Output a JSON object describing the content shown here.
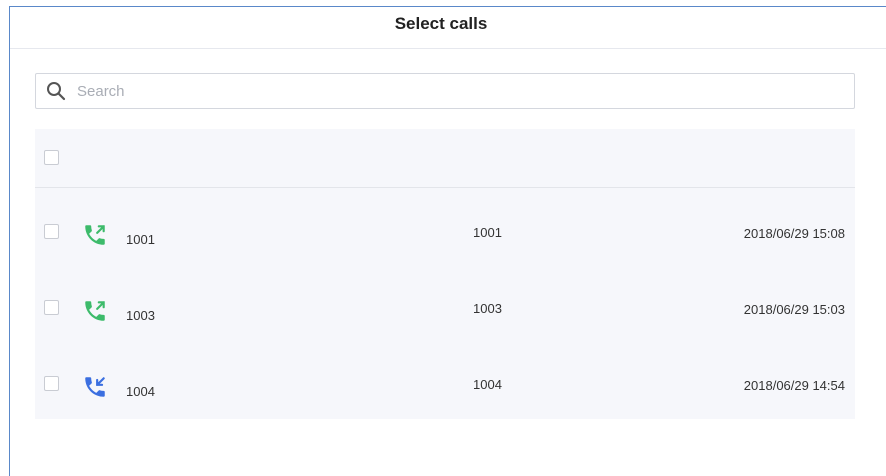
{
  "dialog": {
    "title": "Select calls"
  },
  "search": {
    "placeholder": "Search",
    "value": ""
  },
  "colors": {
    "outgoing_icon": "#3dbb6b",
    "incoming_icon": "#3b6fe0",
    "frame_border": "#5a88c9"
  },
  "calls": [
    {
      "direction": "outgoing",
      "icon": "phone-outgoing-icon",
      "caller": "1001",
      "callee": "1001",
      "time": "2018/06/29 15:08"
    },
    {
      "direction": "outgoing",
      "icon": "phone-outgoing-icon",
      "caller": "1003",
      "callee": "1003",
      "time": "2018/06/29 15:03"
    },
    {
      "direction": "incoming",
      "icon": "phone-incoming-icon",
      "caller": "1004",
      "callee": "1004",
      "time": "2018/06/29 14:54"
    }
  ]
}
